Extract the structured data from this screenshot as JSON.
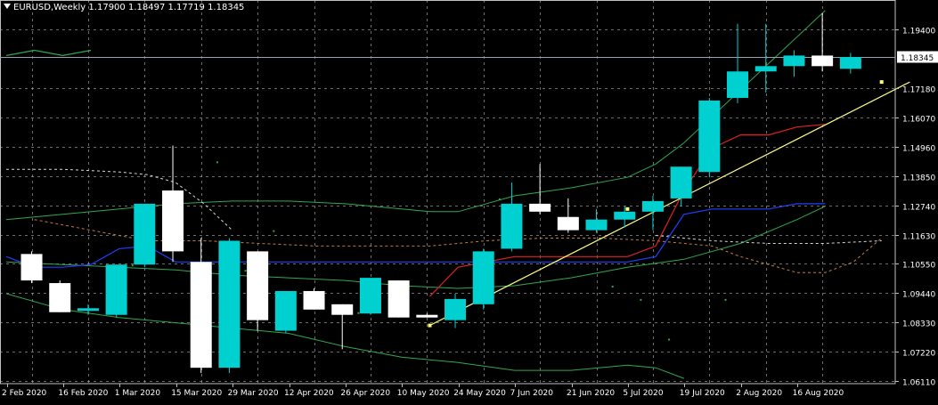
{
  "header": {
    "symbol": "EURUSD,Weekly",
    "open": "1.17900",
    "high": "1.18497",
    "low": "1.17719",
    "close": "1.18345"
  },
  "colors": {
    "background": "#000000",
    "grid": "#c8c8c8",
    "text": "#ffffff",
    "bull": "#00d0d0",
    "bear": "#ffffff",
    "price_line": "#9aa0b8",
    "trendline": "#ffff80",
    "red_line": "#e02020",
    "blue_line": "#2040ff",
    "green_lines": "#30a850",
    "white_dashed": "#d8d8d8",
    "orange_dashed": "#c08040"
  },
  "chart_data": {
    "type": "candlestick",
    "y_ticks": [
      "1.19400",
      "1.17180",
      "1.16070",
      "1.14960",
      "1.13850",
      "1.12740",
      "1.11630",
      "1.10550",
      "1.09440",
      "1.08330",
      "1.07220",
      "1.06110"
    ],
    "ylim": [
      1.06,
      1.205
    ],
    "current_price_label": "1.18345",
    "x_tick_labels": [
      "2 Feb 2020",
      "16 Feb 2020",
      "1 Mar 2020",
      "15 Mar 2020",
      "29 Mar 2020",
      "12 Apr 2020",
      "26 Apr 2020",
      "10 May 2020",
      "24 May 2020",
      "7 Jun 2020",
      "21 Jun 2020",
      "5 Jul 2020",
      "19 Jul 2020",
      "2 Aug 2020",
      "16 Aug 2020"
    ],
    "x_tick_indices": [
      0,
      2,
      4,
      6,
      8,
      10,
      12,
      14,
      16,
      18,
      20,
      22,
      24,
      26,
      28
    ],
    "candles": [
      {
        "o": 1.109,
        "h": 1.11,
        "l": 1.098,
        "c": 1.099
      },
      {
        "o": 1.098,
        "h": 1.099,
        "l": 1.087,
        "c": 1.087
      },
      {
        "o": 1.0875,
        "h": 1.09,
        "l": 1.086,
        "c": 1.0885
      },
      {
        "o": 1.086,
        "h": 1.105,
        "l": 1.085,
        "c": 1.105
      },
      {
        "o": 1.105,
        "h": 1.127,
        "l": 1.104,
        "c": 1.128
      },
      {
        "o": 1.133,
        "h": 1.15,
        "l": 1.106,
        "c": 1.11
      },
      {
        "o": 1.106,
        "h": 1.115,
        "l": 1.064,
        "c": 1.066
      },
      {
        "o": 1.066,
        "h": 1.115,
        "l": 1.064,
        "c": 1.114
      },
      {
        "o": 1.11,
        "h": 1.11,
        "l": 1.08,
        "c": 1.084
      },
      {
        "o": 1.08,
        "h": 1.095,
        "l": 1.079,
        "c": 1.095
      },
      {
        "o": 1.095,
        "h": 1.096,
        "l": 1.088,
        "c": 1.088
      },
      {
        "o": 1.09,
        "h": 1.09,
        "l": 1.073,
        "c": 1.086
      },
      {
        "o": 1.0865,
        "h": 1.1,
        "l": 1.086,
        "c": 1.1
      },
      {
        "o": 1.099,
        "h": 1.099,
        "l": 1.085,
        "c": 1.085
      },
      {
        "o": 1.086,
        "h": 1.0865,
        "l": 1.085,
        "c": 1.085
      },
      {
        "o": 1.084,
        "h": 1.094,
        "l": 1.081,
        "c": 1.092
      },
      {
        "o": 1.09,
        "h": 1.111,
        "l": 1.088,
        "c": 1.11
      },
      {
        "o": 1.111,
        "h": 1.136,
        "l": 1.11,
        "c": 1.128
      },
      {
        "o": 1.128,
        "h": 1.143,
        "l": 1.124,
        "c": 1.125
      },
      {
        "o": 1.123,
        "h": 1.13,
        "l": 1.117,
        "c": 1.118
      },
      {
        "o": 1.118,
        "h": 1.126,
        "l": 1.117,
        "c": 1.122
      },
      {
        "o": 1.122,
        "h": 1.127,
        "l": 1.119,
        "c": 1.125
      },
      {
        "o": 1.125,
        "h": 1.131,
        "l": 1.118,
        "c": 1.129
      },
      {
        "o": 1.13,
        "h": 1.142,
        "l": 1.127,
        "c": 1.142
      },
      {
        "o": 1.14,
        "h": 1.168,
        "l": 1.138,
        "c": 1.167
      },
      {
        "o": 1.168,
        "h": 1.196,
        "l": 1.166,
        "c": 1.178
      },
      {
        "o": 1.178,
        "h": 1.196,
        "l": 1.17,
        "c": 1.18
      },
      {
        "o": 1.18,
        "h": 1.186,
        "l": 1.176,
        "c": 1.184
      },
      {
        "o": 1.184,
        "h": 1.2,
        "l": 1.178,
        "c": 1.18
      },
      {
        "o": 1.179,
        "h": 1.185,
        "l": 1.1772,
        "c": 1.18345
      }
    ],
    "overlays": {
      "red_line": [
        [
          15,
          1.093
        ],
        [
          16,
          1.104
        ],
        [
          17,
          1.106
        ],
        [
          18,
          1.108
        ],
        [
          19,
          1.108
        ],
        [
          20,
          1.108
        ],
        [
          21,
          1.108
        ],
        [
          22,
          1.108
        ],
        [
          23,
          1.112
        ],
        [
          24,
          1.133
        ],
        [
          25,
          1.149
        ],
        [
          26,
          1.154
        ],
        [
          27,
          1.154
        ],
        [
          28,
          1.157
        ],
        [
          29,
          1.158
        ]
      ],
      "blue_line": [
        [
          0,
          1.108
        ],
        [
          1,
          1.104
        ],
        [
          2,
          1.104
        ],
        [
          3,
          1.105
        ],
        [
          4,
          1.111
        ],
        [
          5,
          1.112
        ],
        [
          6,
          1.106
        ],
        [
          8,
          1.106
        ],
        [
          10,
          1.106
        ],
        [
          12,
          1.106
        ],
        [
          14,
          1.106
        ],
        [
          16,
          1.106
        ],
        [
          18,
          1.106
        ],
        [
          20,
          1.106
        ],
        [
          22,
          1.106
        ],
        [
          23,
          1.108
        ],
        [
          24,
          1.124
        ],
        [
          25,
          1.126
        ],
        [
          26,
          1.126
        ],
        [
          27,
          1.126
        ],
        [
          28,
          1.128
        ],
        [
          29,
          1.128
        ]
      ],
      "green_upper": [
        [
          0,
          1.122
        ],
        [
          2,
          1.124
        ],
        [
          4,
          1.126
        ],
        [
          6,
          1.128
        ],
        [
          8,
          1.129
        ],
        [
          10,
          1.129
        ],
        [
          12,
          1.128
        ],
        [
          14,
          1.126
        ],
        [
          15,
          1.125
        ],
        [
          16,
          1.125
        ],
        [
          18,
          1.131
        ],
        [
          20,
          1.134
        ],
        [
          22,
          1.138
        ],
        [
          23,
          1.143
        ],
        [
          24,
          1.151
        ],
        [
          25,
          1.161
        ],
        [
          26,
          1.171
        ],
        [
          27,
          1.181
        ],
        [
          28,
          1.191
        ],
        [
          29,
          1.201
        ]
      ],
      "green_mid": [
        [
          0,
          1.106
        ],
        [
          2,
          1.105
        ],
        [
          4,
          1.104
        ],
        [
          6,
          1.103
        ],
        [
          8,
          1.101
        ],
        [
          10,
          1.1
        ],
        [
          12,
          1.099
        ],
        [
          14,
          1.097
        ],
        [
          16,
          1.096
        ],
        [
          18,
          1.097
        ],
        [
          20,
          1.1
        ],
        [
          22,
          1.104
        ],
        [
          24,
          1.107
        ],
        [
          26,
          1.113
        ],
        [
          28,
          1.122
        ],
        [
          29,
          1.127
        ]
      ],
      "green_lower": [
        [
          0,
          1.094
        ],
        [
          2,
          1.088
        ],
        [
          4,
          1.085
        ],
        [
          6,
          1.083
        ],
        [
          8,
          1.081
        ],
        [
          10,
          1.079
        ],
        [
          12,
          1.074
        ],
        [
          14,
          1.07
        ],
        [
          16,
          1.068
        ],
        [
          18,
          1.065
        ],
        [
          20,
          1.065
        ],
        [
          22,
          1.067
        ],
        [
          23,
          1.066
        ],
        [
          24,
          1.062
        ]
      ],
      "green_top_left": [
        [
          0,
          1.184
        ],
        [
          1,
          1.186
        ],
        [
          2,
          1.184
        ],
        [
          3,
          1.186
        ]
      ],
      "white_dashed": [
        [
          0,
          1.141
        ],
        [
          2,
          1.141
        ],
        [
          4,
          1.14
        ],
        [
          5,
          1.139
        ],
        [
          6,
          1.136
        ],
        [
          7,
          1.128
        ],
        [
          8,
          1.118
        ]
      ],
      "white_dashed_2": [
        [
          23,
          1.116
        ],
        [
          25,
          1.114
        ],
        [
          27,
          1.113
        ],
        [
          29,
          1.113
        ],
        [
          31,
          1.114
        ]
      ],
      "orange_dashed": [
        [
          1,
          1.122
        ],
        [
          3,
          1.118
        ],
        [
          5,
          1.114
        ],
        [
          7,
          1.114
        ],
        [
          9,
          1.113
        ],
        [
          11,
          1.112
        ],
        [
          13,
          1.112
        ],
        [
          15,
          1.112
        ],
        [
          17,
          1.114
        ],
        [
          19,
          1.115
        ],
        [
          21,
          1.115
        ],
        [
          23,
          1.114
        ],
        [
          25,
          1.112
        ],
        [
          26,
          1.108
        ],
        [
          28,
          1.102
        ],
        [
          29,
          1.102
        ],
        [
          30,
          1.106
        ],
        [
          31,
          1.115
        ]
      ],
      "trendline": [
        [
          15,
          1.082
        ],
        [
          32,
          1.174
        ]
      ]
    },
    "small_markers": [
      {
        "i": 15,
        "v": 1.082
      },
      {
        "i": 22,
        "v": 1.126
      },
      {
        "i": 31,
        "v": 1.174
      }
    ]
  }
}
